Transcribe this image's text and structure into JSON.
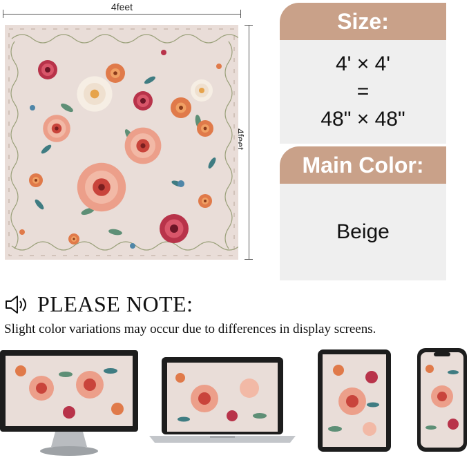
{
  "dimensions": {
    "width_label": "4feet",
    "height_label": "4feet"
  },
  "size_panel": {
    "header": "Size:",
    "line1": "4' × 4'",
    "line2": "=",
    "line3": "48\" × 48\""
  },
  "color_panel": {
    "header": "Main Color:",
    "value": "Beige"
  },
  "note": {
    "title": "PLEASE NOTE:",
    "text": "Slight color variations may occur due to differences in display screens."
  },
  "colors": {
    "accent": "#c9a189",
    "panel_bg": "#efefef",
    "rug_bg": "#e9ddd8"
  },
  "icons": {
    "speaker": "speaker-icon"
  }
}
